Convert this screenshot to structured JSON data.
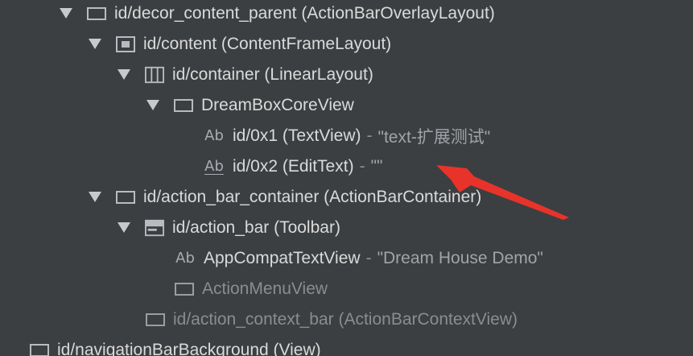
{
  "tree": {
    "rows": [
      {
        "label": "id/decor_content_parent (ActionBarOverlayLayout)"
      },
      {
        "label": "id/content (ContentFrameLayout)"
      },
      {
        "label": "id/container (LinearLayout)"
      },
      {
        "label": "DreamBoxCoreView"
      },
      {
        "label": "id/0x1 (TextView)",
        "sep": "-",
        "value": "\"text-扩展测试\"",
        "icon_text": "Ab"
      },
      {
        "label": "id/0x2 (EditText)",
        "sep": "-",
        "value": "\"\"",
        "icon_text": "Ab"
      },
      {
        "label": "id/action_bar_container (ActionBarContainer)"
      },
      {
        "label": "id/action_bar (Toolbar)"
      },
      {
        "label": "AppCompatTextView",
        "sep": "-",
        "value": "\"Dream House Demo\"",
        "icon_text": "Ab"
      },
      {
        "label": "ActionMenuView"
      },
      {
        "label": "id/action_context_bar (ActionBarContextView)"
      },
      {
        "label": "id/navigationBarBackground (View)"
      }
    ]
  },
  "colors": {
    "background": "#3c3f41",
    "text": "#dadada",
    "dim_text": "#8a8d90",
    "arrow": "#e8332a"
  },
  "icons": {
    "view": "view-icon",
    "frame": "frame-layout-icon",
    "linear": "linear-layout-icon",
    "toolbar": "toolbar-icon",
    "text": "text-view-icon",
    "edit": "edit-text-icon",
    "expand": "triangle-down-icon"
  }
}
